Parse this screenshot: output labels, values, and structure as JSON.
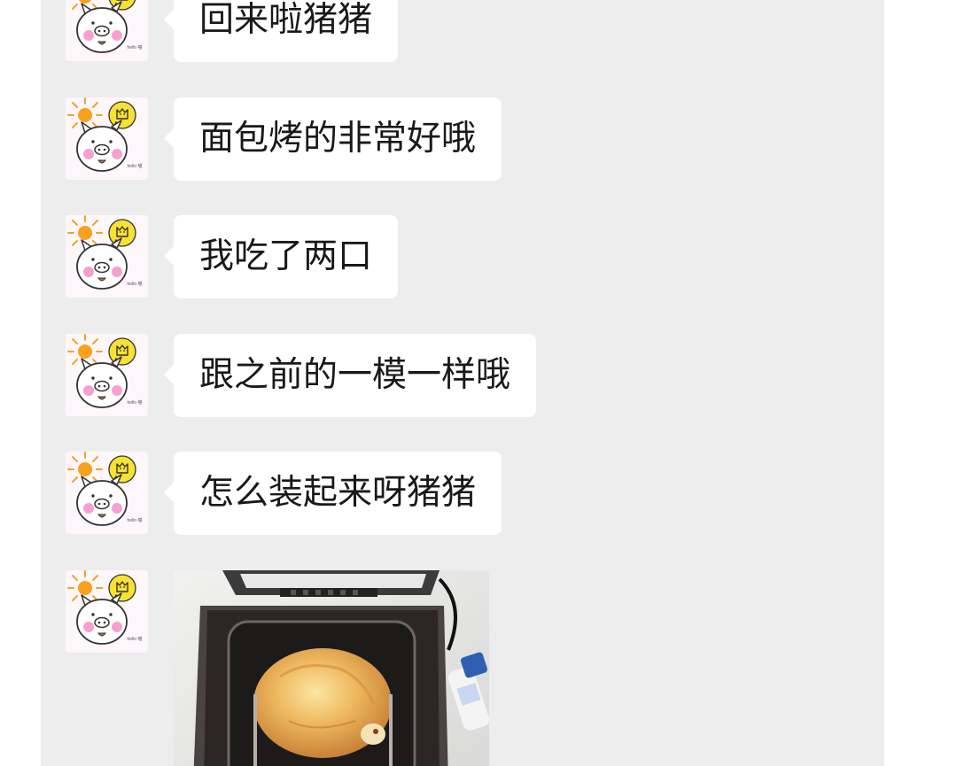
{
  "messages": [
    {
      "type": "text",
      "text": "回来啦猪猪"
    },
    {
      "type": "text",
      "text": "面包烤的非常好哦"
    },
    {
      "type": "text",
      "text": "我吃了两口"
    },
    {
      "type": "text",
      "text": "跟之前的一模一样哦"
    },
    {
      "type": "text",
      "text": "怎么装起来呀猪猪"
    },
    {
      "type": "image",
      "image": "bread-in-bread-machine-photo"
    }
  ],
  "avatar": {
    "icon": "pig-with-sun-avatar",
    "caption": "hello 喵"
  }
}
